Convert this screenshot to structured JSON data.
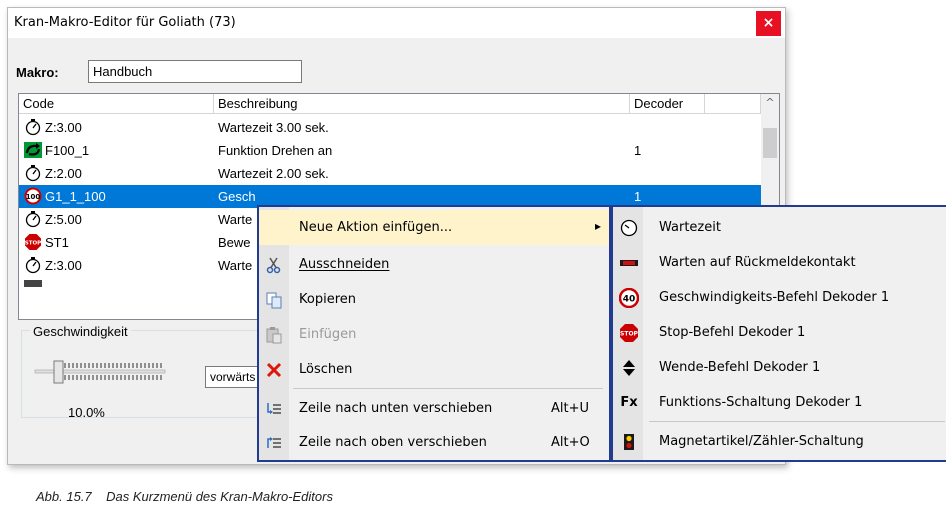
{
  "window": {
    "title": "Kran-Makro-Editor für Goliath  (73)",
    "close_glyph": "×"
  },
  "makro": {
    "label": "Makro:",
    "value": "Handbuch"
  },
  "list": {
    "headers": [
      "Code",
      "Beschreibung",
      "Decoder",
      ""
    ],
    "rows": [
      {
        "icon": "stopwatch-icon",
        "code": "Z:3.00",
        "desc": "Wartezeit 3.00 sek.",
        "decoder": ""
      },
      {
        "icon": "green-rotate-icon",
        "code": "F100_1",
        "desc": "Funktion Drehen an",
        "decoder": "1"
      },
      {
        "icon": "stopwatch-icon",
        "code": "Z:2.00",
        "desc": "Wartezeit 2.00 sek.",
        "decoder": ""
      },
      {
        "icon": "speed-sign-icon",
        "code": "G1_1_100",
        "desc": "Gesch",
        "decoder": "1",
        "selected": true
      },
      {
        "icon": "stopwatch-icon",
        "code": "Z:5.00",
        "desc": "Warte",
        "decoder": ""
      },
      {
        "icon": "stop-sign-icon",
        "code": "ST1",
        "desc": "Bewe",
        "decoder": ""
      },
      {
        "icon": "stopwatch-icon",
        "code": "Z:3.00",
        "desc": "Warte",
        "decoder": ""
      }
    ],
    "scroll_up_glyph": "^"
  },
  "speed": {
    "group_label": "Geschwindigkeit",
    "value": "10.0%",
    "level": 0.1,
    "direction": "vorwärts"
  },
  "context_menu": {
    "items": [
      {
        "label": "Neue Aktion einfügen...",
        "shortcut": "",
        "icon": "",
        "highlighted": true,
        "submenu_arrow": "▸"
      },
      {
        "label": "Ausschneiden",
        "shortcut": "",
        "icon": "scissors-icon"
      },
      {
        "label": "Kopieren",
        "shortcut": "",
        "icon": "copy-icon"
      },
      {
        "label": "Einfügen",
        "shortcut": "",
        "icon": "paste-icon",
        "disabled": true
      },
      {
        "label": "Löschen",
        "shortcut": "",
        "icon": "delete-icon"
      },
      {
        "label": "Zeile nach unten verschieben",
        "shortcut": "Alt+U",
        "icon": "move-down-icon"
      },
      {
        "label": "Zeile nach oben verschieben",
        "shortcut": "Alt+O",
        "icon": "move-up-icon"
      }
    ]
  },
  "submenu": {
    "items": [
      {
        "label": "Wartezeit",
        "icon": "stopwatch-icon"
      },
      {
        "label": "Warten auf Rückmeldekontakt",
        "icon": "feedback-contact-icon"
      },
      {
        "label": "Geschwindigkeits-Befehl Dekoder 1",
        "icon": "speed-sign-icon",
        "icon_text": "40"
      },
      {
        "label": "Stop-Befehl Dekoder 1",
        "icon": "stop-sign-icon",
        "icon_text": "STOP"
      },
      {
        "label": "Wende-Befehl Dekoder 1",
        "icon": "reverse-arrows-icon"
      },
      {
        "label": "Funktions-Schaltung Dekoder 1",
        "icon": "function-icon",
        "icon_text": "Fx"
      },
      {
        "label": "Magnetartikel/Zähler-Schaltung",
        "icon": "signal-icon"
      }
    ]
  },
  "caption": "Abb. 15.7    Das Kurzmenü des Kran-Makro-Editors",
  "colors": {
    "selection": "#0078d7",
    "menu_border": "#203b8f",
    "highlight": "#fff3cc",
    "close": "#e81123"
  }
}
